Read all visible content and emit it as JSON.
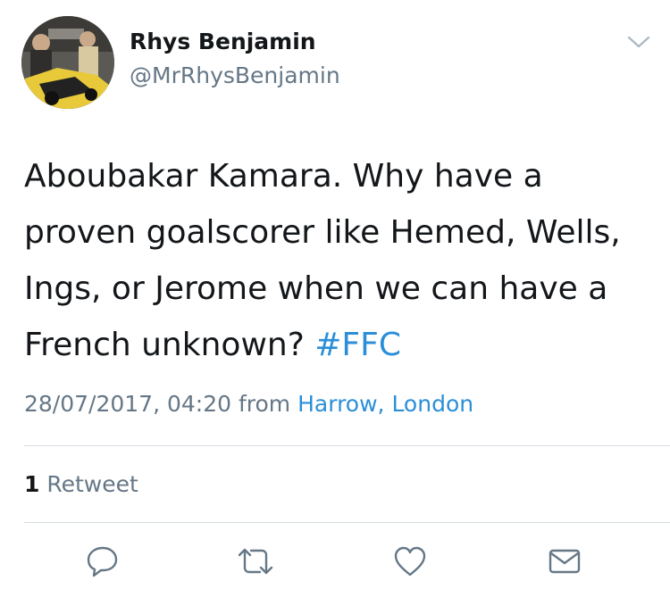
{
  "user": {
    "name": "Rhys Benjamin",
    "handle": "@MrRhysBenjamin"
  },
  "tweet": {
    "text_lines": [
      "Aboubakar Kamara. Why have a",
      "proven goalscorer like Hemed, Wells,",
      "Ings, or Jerome when we can have a",
      "French unknown?"
    ],
    "hashtag": "#FFC",
    "timestamp": "28/07/2017, 04:20",
    "from_label": "from",
    "location": "Harrow, London"
  },
  "stats": {
    "retweet_count": "1",
    "retweet_label": "Retweet"
  },
  "icons": {
    "caret": "chevron-down-icon",
    "reply": "reply-icon",
    "retweet": "retweet-icon",
    "like": "heart-icon",
    "dm": "envelope-icon"
  },
  "colors": {
    "link": "#2b8fd8",
    "secondary_text": "#657786",
    "primary_text": "#14171a",
    "icon": "#657786",
    "divider": "#d7dde2"
  }
}
